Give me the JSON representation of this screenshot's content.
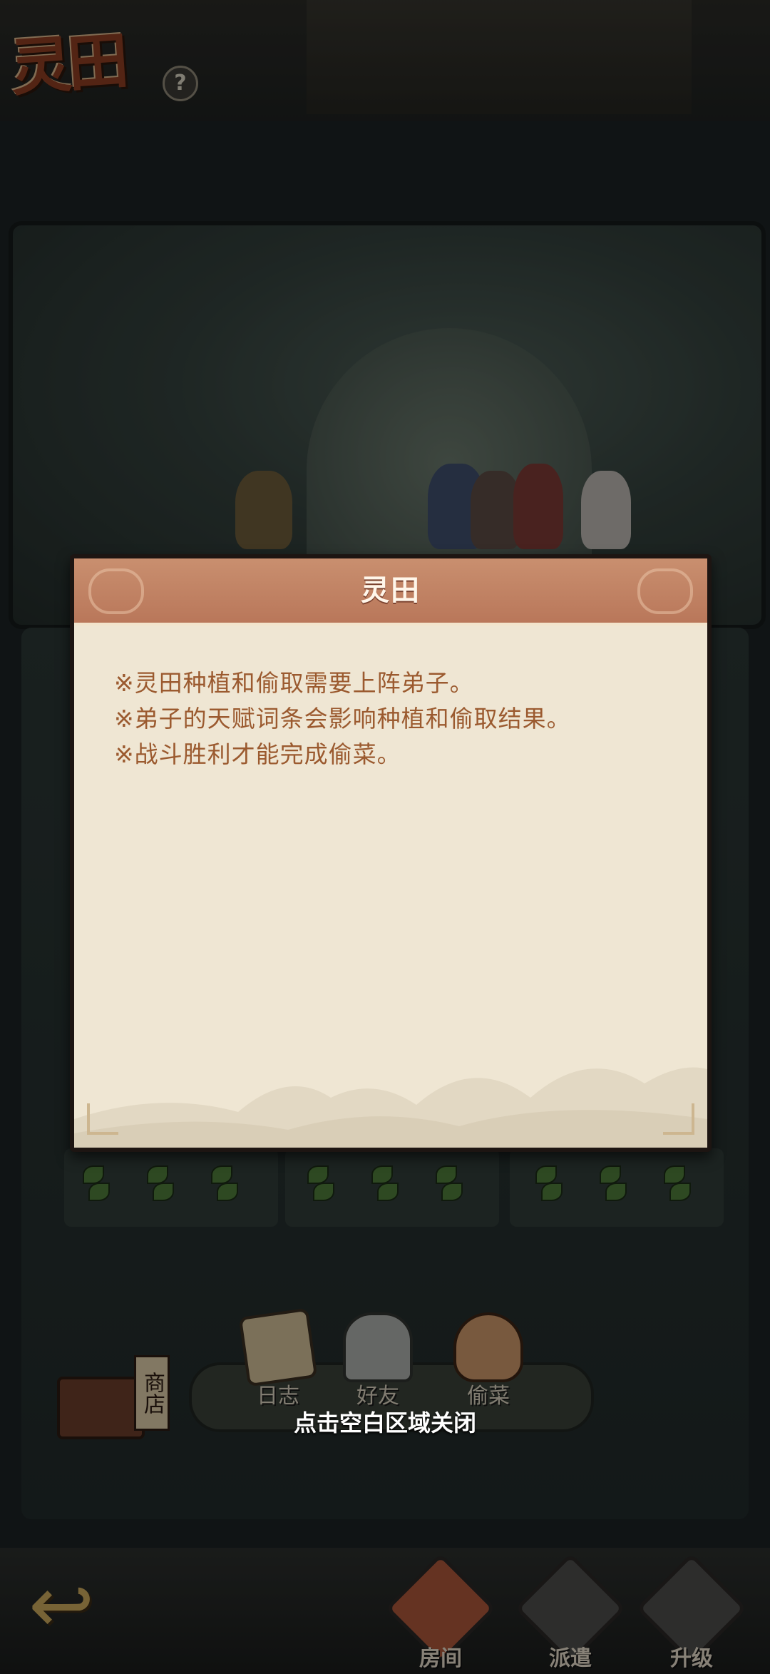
{
  "dialog": {
    "title": "灵田",
    "rules": [
      "※灵田种植和偷取需要上阵弟子。",
      "※弟子的天赋词条会影响种植和偷取结果。",
      "※战斗胜利才能完成偷菜。"
    ]
  },
  "hint": "点击空白区域关闭",
  "header": {
    "logo_text": "灵田",
    "help_icon": "?"
  },
  "toolbar": {
    "shop_label": "商店",
    "items": [
      {
        "label": "日志",
        "icon": "scroll-icon"
      },
      {
        "label": "好友",
        "icon": "friends-icon"
      },
      {
        "label": "偷菜",
        "icon": "sack-icon"
      }
    ]
  },
  "bottom_nav": {
    "items": [
      {
        "label": "房间",
        "icon": "house-icon"
      },
      {
        "label": "派遣",
        "icon": "flag-icon"
      },
      {
        "label": "升级",
        "icon": "upgrade-icon"
      }
    ]
  },
  "colors": {
    "dialog_bg": "#efe6d3",
    "dialog_header": "#b9775a",
    "rule_text": "#9b5a2f"
  }
}
